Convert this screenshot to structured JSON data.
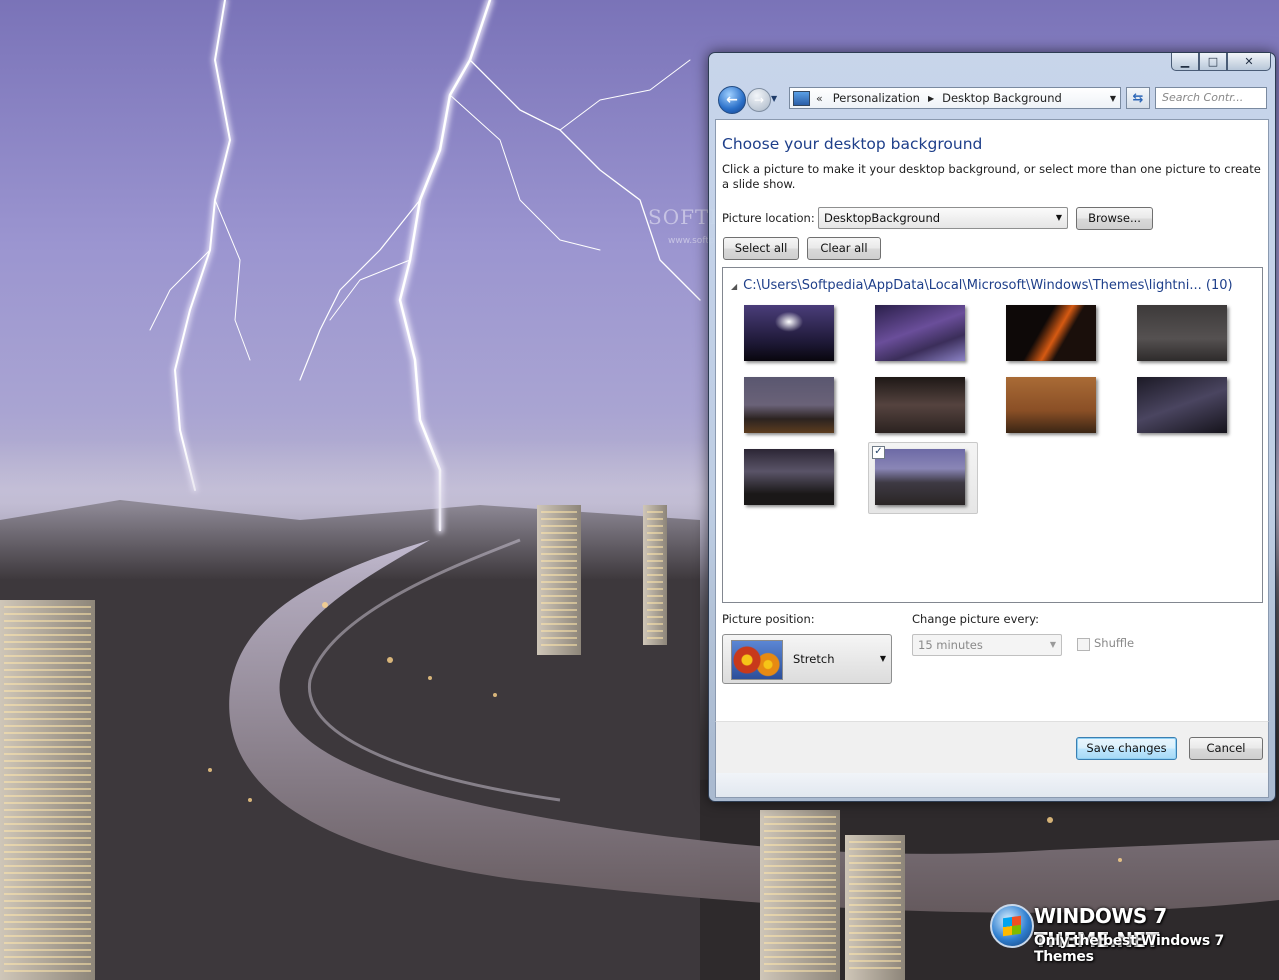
{
  "desktop": {
    "watermark": "SOFTPEDIA",
    "watermark_url": "www.softpedia.com",
    "brand_title": "WINDOWS 7 THEME.NET",
    "brand_subtitle": "Only the best Windows 7 Themes"
  },
  "window": {
    "controls": {
      "minimize": "▁",
      "maximize": "□",
      "close": "✕"
    },
    "nav": {
      "back_glyph": "←",
      "forward_glyph": "→",
      "address_chevron": "«",
      "breadcrumbs": [
        "Personalization",
        "Desktop Background"
      ],
      "search_placeholder": "Search Contr..."
    },
    "heading": "Choose your desktop background",
    "description": "Click a picture to make it your desktop background, or select more than one picture to create a slide show.",
    "picture_location": {
      "label": "Picture location:",
      "value": "DesktopBackground",
      "browse_label": "Browse..."
    },
    "select_all_label": "Select all",
    "clear_all_label": "Clear all",
    "group": {
      "path": "C:\\Users\\Softpedia\\AppData\\Local\\Microsoft\\Windows\\Themes\\lightni...",
      "count": "(10)"
    },
    "thumbnails": [
      {
        "name": "lightning-thumb-1",
        "selected": false
      },
      {
        "name": "lightning-thumb-2",
        "selected": false
      },
      {
        "name": "lightning-thumb-3",
        "selected": false
      },
      {
        "name": "lightning-thumb-4",
        "selected": false
      },
      {
        "name": "lightning-thumb-5",
        "selected": false
      },
      {
        "name": "lightning-thumb-6",
        "selected": false
      },
      {
        "name": "lightning-thumb-7",
        "selected": false
      },
      {
        "name": "lightning-thumb-8",
        "selected": false
      },
      {
        "name": "lightning-thumb-9",
        "selected": false
      },
      {
        "name": "lightning-thumb-10",
        "selected": true
      }
    ],
    "picture_position": {
      "label": "Picture position:",
      "value": "Stretch"
    },
    "change_picture": {
      "label": "Change picture every:",
      "value": "15 minutes",
      "enabled": false
    },
    "shuffle_label": "Shuffle",
    "save_label": "Save changes",
    "cancel_label": "Cancel"
  }
}
